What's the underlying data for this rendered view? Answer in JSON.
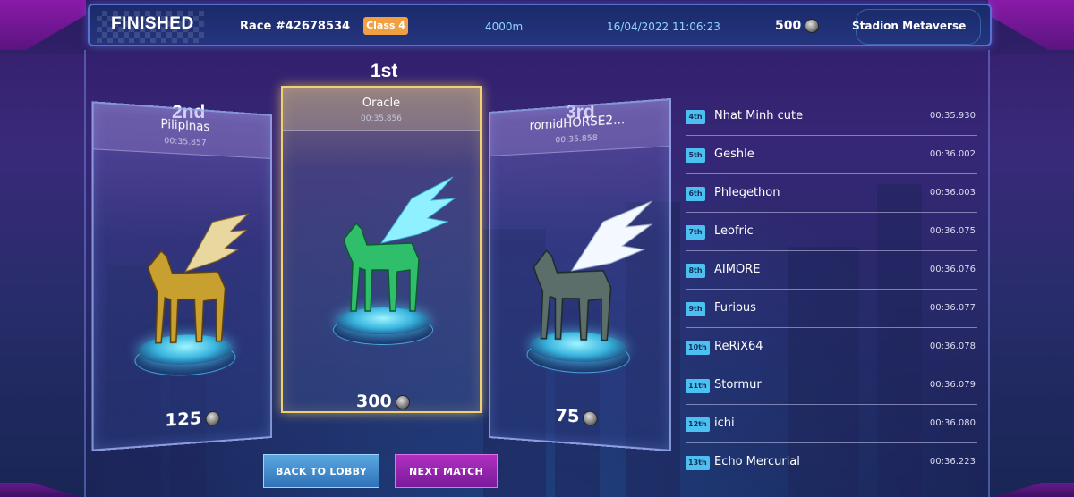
{
  "header": {
    "status": "FINISHED",
    "race": "Race #42678534",
    "class": "Class 4",
    "distance": "4000m",
    "date": "16/04/2022 11:06:23",
    "prize": "500",
    "venue": "Stadion Metaverse"
  },
  "podium": {
    "first": {
      "rank": "1st",
      "name": "Oracle",
      "time": "00:35.856",
      "reward": "300",
      "color": "#2fbf6a"
    },
    "second": {
      "rank": "2nd",
      "name": "Pilipinas",
      "time": "00:35.857",
      "reward": "125",
      "color": "#d4a62a"
    },
    "third": {
      "rank": "3rd",
      "name": "romidHORSE2...",
      "time": "00:35.858",
      "reward": "75",
      "color": "#5c6e6a"
    }
  },
  "results": [
    {
      "rank": "4th",
      "name": "Nhat Minh cute",
      "time": "00:35.930"
    },
    {
      "rank": "5th",
      "name": "Geshle",
      "time": "00:36.002"
    },
    {
      "rank": "6th",
      "name": "Phlegethon",
      "time": "00:36.003"
    },
    {
      "rank": "7th",
      "name": "Leofric",
      "time": "00:36.075"
    },
    {
      "rank": "8th",
      "name": "AIMORE",
      "time": "00:36.076"
    },
    {
      "rank": "9th",
      "name": "Furious",
      "time": "00:36.077"
    },
    {
      "rank": "10th",
      "name": "ReRiX64",
      "time": "00:36.078"
    },
    {
      "rank": "11th",
      "name": "Stormur",
      "time": "00:36.079"
    },
    {
      "rank": "12th",
      "name": "ichi",
      "time": "00:36.080"
    },
    {
      "rank": "13th",
      "name": "Echo Mercurial",
      "time": "00:36.223"
    }
  ],
  "buttons": {
    "back": "BACK TO LOBBY",
    "next": "NEXT MATCH"
  },
  "icons": {
    "currency": "coin-icon"
  }
}
